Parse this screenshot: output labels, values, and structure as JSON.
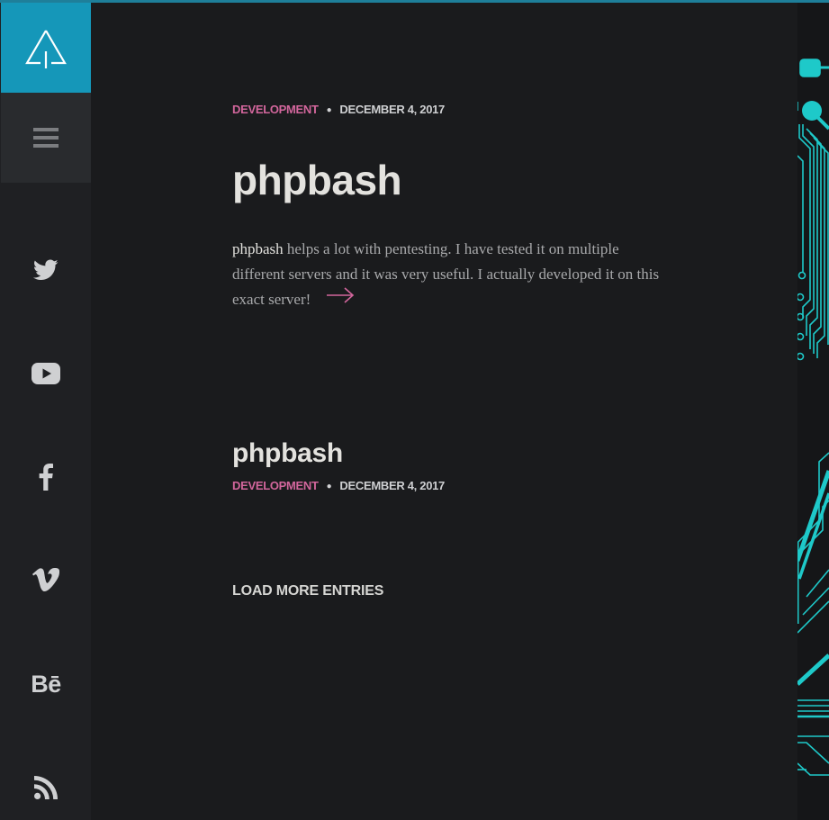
{
  "header": {
    "accent_line_color": "#1e7f9a"
  },
  "sidebar": {
    "logo_icon": "triangle-tree-logo-icon",
    "menu_icon": "hamburger-menu-icon",
    "social": [
      {
        "name": "twitter-icon"
      },
      {
        "name": "youtube-icon"
      },
      {
        "name": "facebook-icon"
      },
      {
        "name": "vimeo-icon"
      },
      {
        "name": "behance-icon",
        "text": "Bē"
      },
      {
        "name": "rss-icon"
      }
    ],
    "accent_color": "#1597b9"
  },
  "posts": [
    {
      "category": "DEVELOPMENT",
      "date": "DECEMBER 4, 2017",
      "title": "phpbash",
      "excerpt_lead": "phpbash",
      "excerpt_rest": " helps a lot with pentesting. I have tested it on multiple different servers and it was very useful. I actually developed it on this exact server!"
    },
    {
      "title": "phpbash",
      "category": "DEVELOPMENT",
      "date": "DECEMBER 4, 2017"
    }
  ],
  "load_more_label": "LOAD MORE ENTRIES",
  "colors": {
    "category": "#d2669c",
    "circuit": "#1ec9c9",
    "background": "#1a1b1d"
  }
}
